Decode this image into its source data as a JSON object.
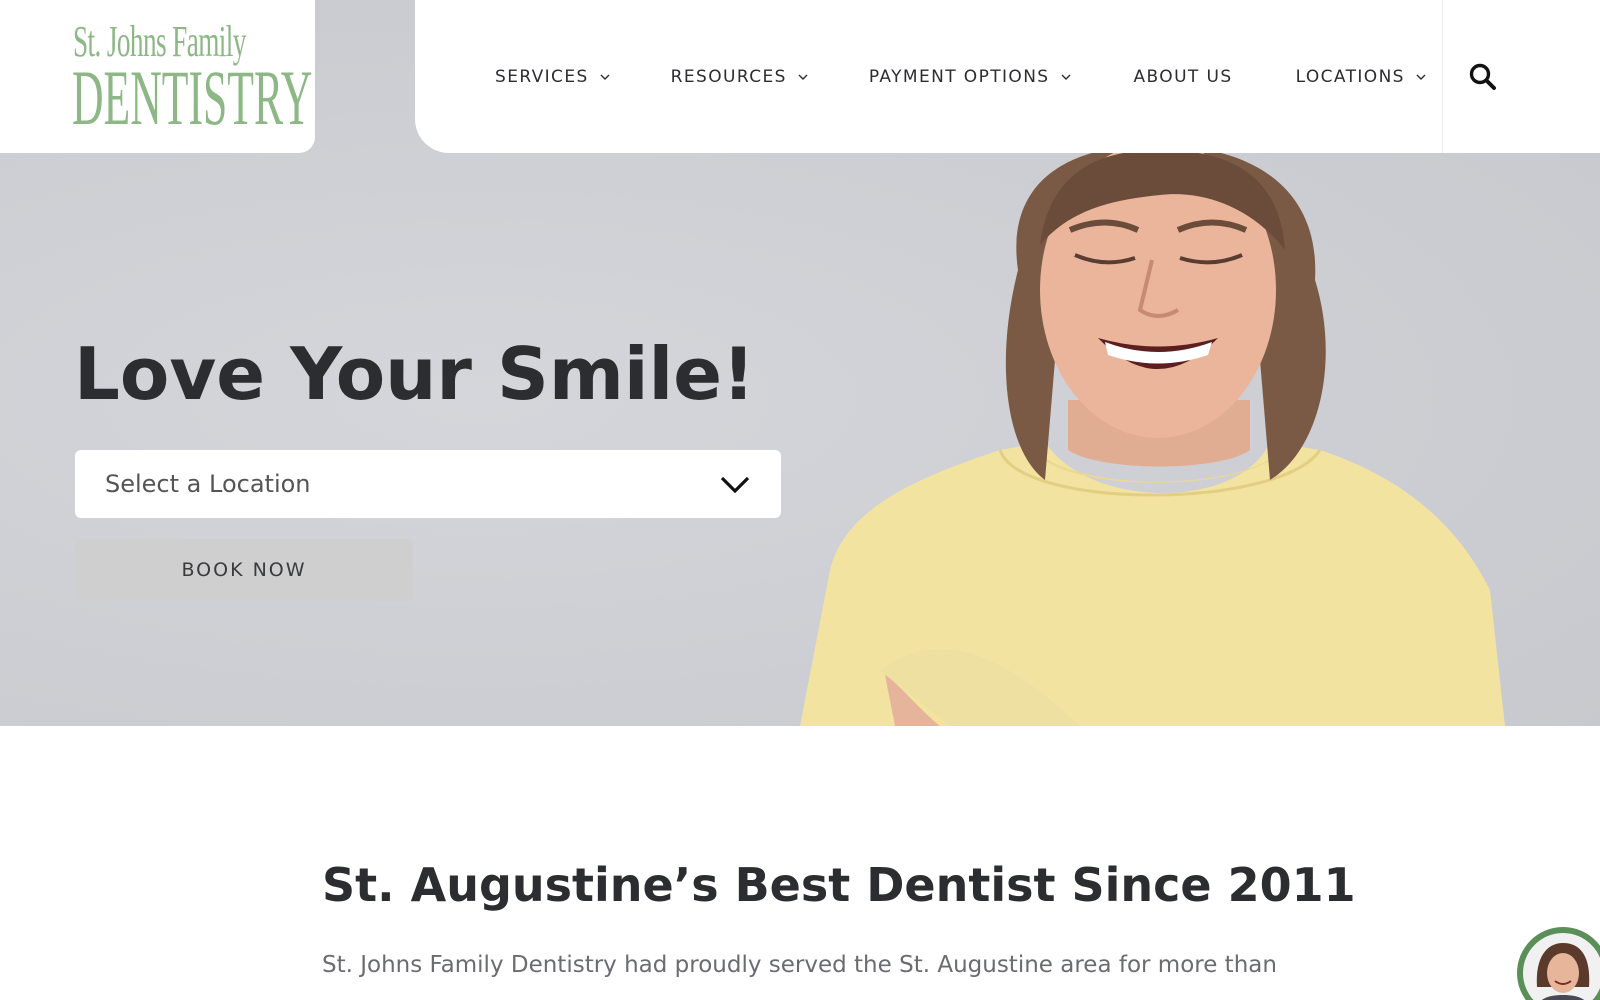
{
  "brand": {
    "line1": "St. Johns Family",
    "line2": "DENTISTRY",
    "color": "#8db886"
  },
  "nav": {
    "items": [
      {
        "label": "SERVICES",
        "has_dropdown": true
      },
      {
        "label": "RESOURCES",
        "has_dropdown": true
      },
      {
        "label": "PAYMENT OPTIONS",
        "has_dropdown": true
      },
      {
        "label": "ABOUT US",
        "has_dropdown": false
      },
      {
        "label": "LOCATIONS",
        "has_dropdown": true
      }
    ],
    "search_icon": "search-icon"
  },
  "hero": {
    "title": "Love Your Smile!",
    "location_select": {
      "selected": "Select a Location"
    },
    "book_button": "BOOK NOW",
    "background": "#ccced3"
  },
  "section": {
    "title": "St. Augustine’s Best Dentist Since 2011",
    "text": "St. Johns Family Dentistry had proudly served the St. Augustine area for more than"
  },
  "chat": {
    "icon": "chat-avatar-icon",
    "color": "#5a8f57"
  }
}
